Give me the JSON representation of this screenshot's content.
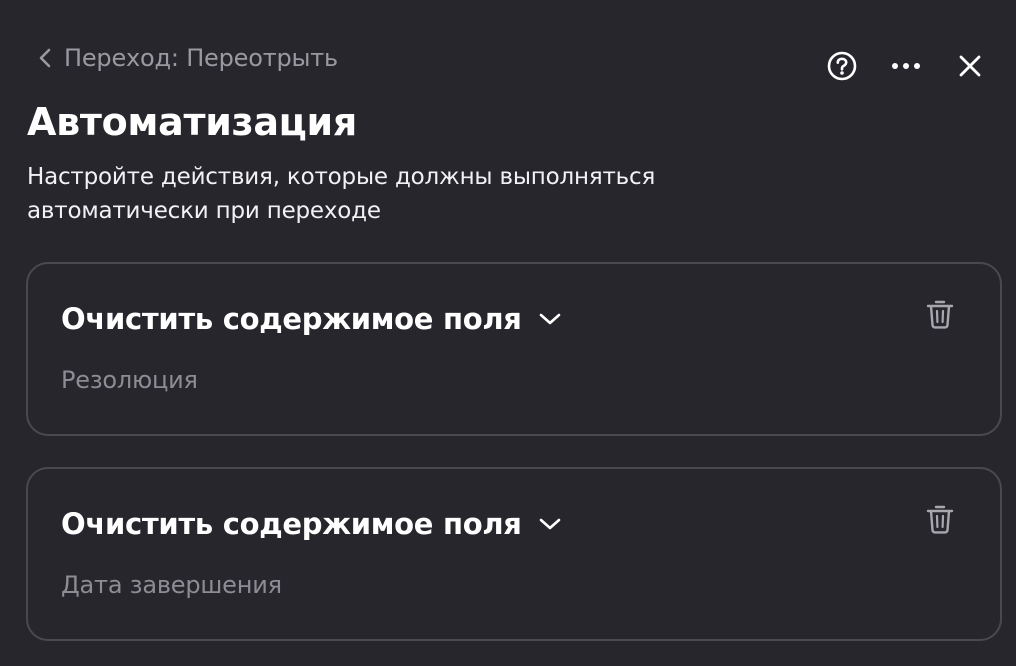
{
  "header": {
    "back_label": "Переход: Переотрыть",
    "icons": {
      "back": "chevron-left-icon",
      "help": "help-circle-icon",
      "more": "more-horizontal-icon",
      "close": "close-icon"
    }
  },
  "main": {
    "title": "Автоматизация",
    "description": "Настройте действия, которые должны выполняться автоматически при переходе",
    "actions": [
      {
        "action_label": "Очистить содержимое поля",
        "field_name": "Резолюция",
        "icons": {
          "dropdown": "chevron-down-icon",
          "delete": "trash-icon"
        }
      },
      {
        "action_label": "Очистить содержимое поля",
        "field_name": "Дата завершения",
        "icons": {
          "dropdown": "chevron-down-icon",
          "delete": "trash-icon"
        }
      }
    ]
  },
  "colors": {
    "background": "#27262d",
    "card_border": "#4a4950",
    "text_primary": "#ffffff",
    "text_secondary": "#8d8c93",
    "icon_muted": "#a8a7ae"
  }
}
